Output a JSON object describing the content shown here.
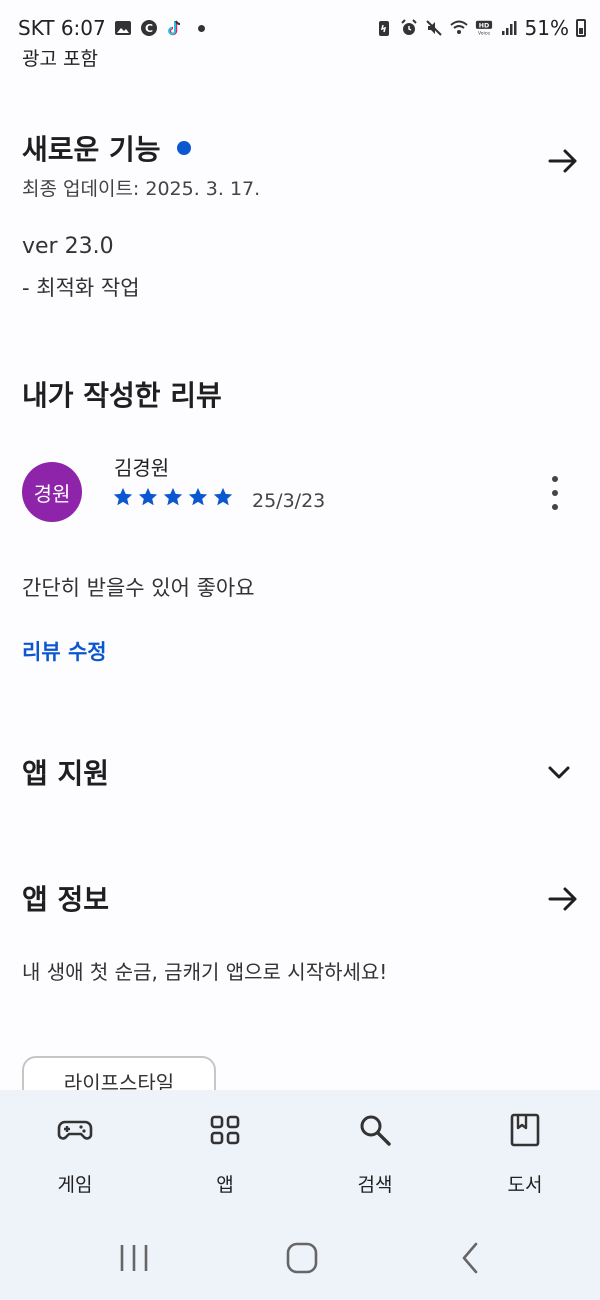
{
  "status_bar": {
    "carrier_time": "SKT 6:07",
    "battery": "51%"
  },
  "ad_label": "광고 포함",
  "whats_new": {
    "title": "새로운 기능",
    "updated": "최종 업데이트: 2025. 3. 17.",
    "version": "ver 23.0",
    "notes": "- 최적화 작업"
  },
  "my_review": {
    "title": "내가 작성한 리뷰",
    "avatar_text": "경원",
    "reviewer": "김경원",
    "rating": 5,
    "date": "25/3/23",
    "text": "간단히 받을수 있어 좋아요",
    "edit_label": "리뷰 수정"
  },
  "app_support": {
    "title": "앱 지원"
  },
  "app_info": {
    "title": "앱 정보",
    "description": "내 생애 첫 순금, 금캐기 앱으로 시작하세요!",
    "category_chip": "라이프스타일"
  },
  "bottom_nav": {
    "items": [
      {
        "label": "게임",
        "icon": "gamepad-icon"
      },
      {
        "label": "앱",
        "icon": "apps-grid-icon"
      },
      {
        "label": "검색",
        "icon": "search-icon"
      },
      {
        "label": "도서",
        "icon": "book-icon"
      }
    ]
  },
  "colors": {
    "accent": "#0b57d0",
    "avatar": "#8e24aa",
    "nav_background": "#eef2f9"
  }
}
